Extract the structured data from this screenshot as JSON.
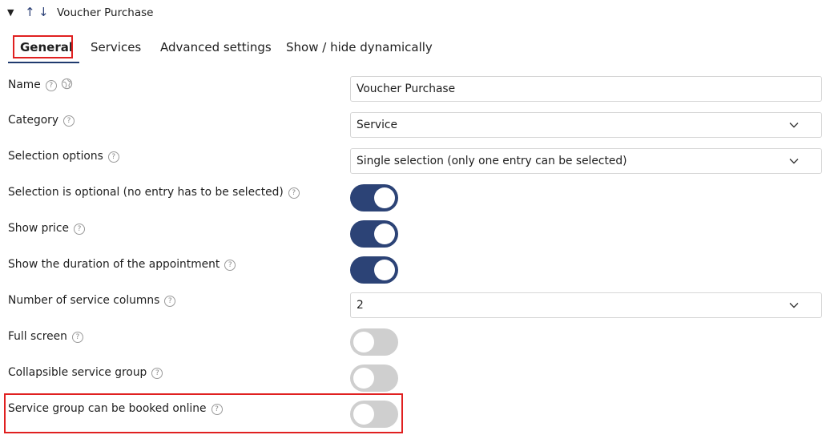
{
  "header": {
    "caret": "▼",
    "arrow_up": "↑",
    "arrow_down": "↓",
    "title": "Voucher Purchase"
  },
  "tabs": [
    {
      "label": "General",
      "active": true
    },
    {
      "label": "Services",
      "active": false
    },
    {
      "label": "Advanced settings",
      "active": false
    },
    {
      "label": "Show / hide dynamically",
      "active": false
    }
  ],
  "help_glyph": "?",
  "form": {
    "name": {
      "label": "Name",
      "value": "Voucher Purchase"
    },
    "category": {
      "label": "Category",
      "value": "Service"
    },
    "selection_options": {
      "label": "Selection options",
      "value": "Single selection (only one entry can be selected)"
    },
    "selection_optional": {
      "label": "Selection is optional (no entry has to be selected)",
      "on": true
    },
    "show_price": {
      "label": "Show price",
      "on": true
    },
    "show_duration": {
      "label": "Show the duration of the appointment",
      "on": true
    },
    "service_columns": {
      "label": "Number of service columns",
      "value": "2"
    },
    "full_screen": {
      "label": "Full screen",
      "on": false
    },
    "collapsible_group": {
      "label": "Collapsible service group",
      "on": false
    },
    "bookable_online": {
      "label": "Service group can be booked online",
      "on": false
    }
  },
  "colors": {
    "toggle_on": "#2c4376",
    "toggle_off": "#cfcfcf",
    "highlight": "#e02020"
  }
}
